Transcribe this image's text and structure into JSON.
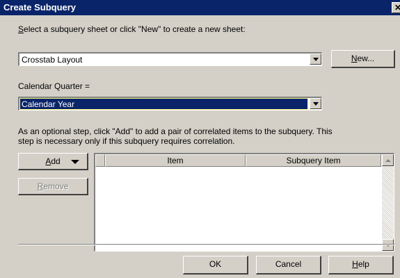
{
  "window": {
    "title": "Create Subquery"
  },
  "subquery_sheet": {
    "label": "Select a subquery sheet or click \"New\" to create a new sheet:",
    "label_mnemonic": "S",
    "label_rest": "elect a subquery sheet or click \"New\" to create a new sheet:",
    "value": "Crosstab Layout"
  },
  "buttons": {
    "new_mnemonic": "N",
    "new_rest": "ew...",
    "add_mnemonic": "A",
    "add_rest": "dd",
    "remove_mnemonic": "R",
    "remove_rest": "emove",
    "ok": "OK",
    "cancel": "Cancel",
    "help_mnemonic": "H",
    "help_rest": "elp"
  },
  "calendar": {
    "label": "Calendar Quarter =",
    "value": "Calendar Year"
  },
  "instructions": {
    "line1": "As an optional step, click \"Add\" to add a pair of correlated items to the subquery. This",
    "line2": "step is necessary only if this subquery requires correlation."
  },
  "table": {
    "columns": [
      "Item",
      "Subquery Item"
    ],
    "rows": []
  },
  "icons": {
    "close": "close-icon",
    "dropdown": "chevron-down-icon",
    "scroll_up": "scroll-up-icon",
    "scroll_down": "scroll-down-icon"
  }
}
